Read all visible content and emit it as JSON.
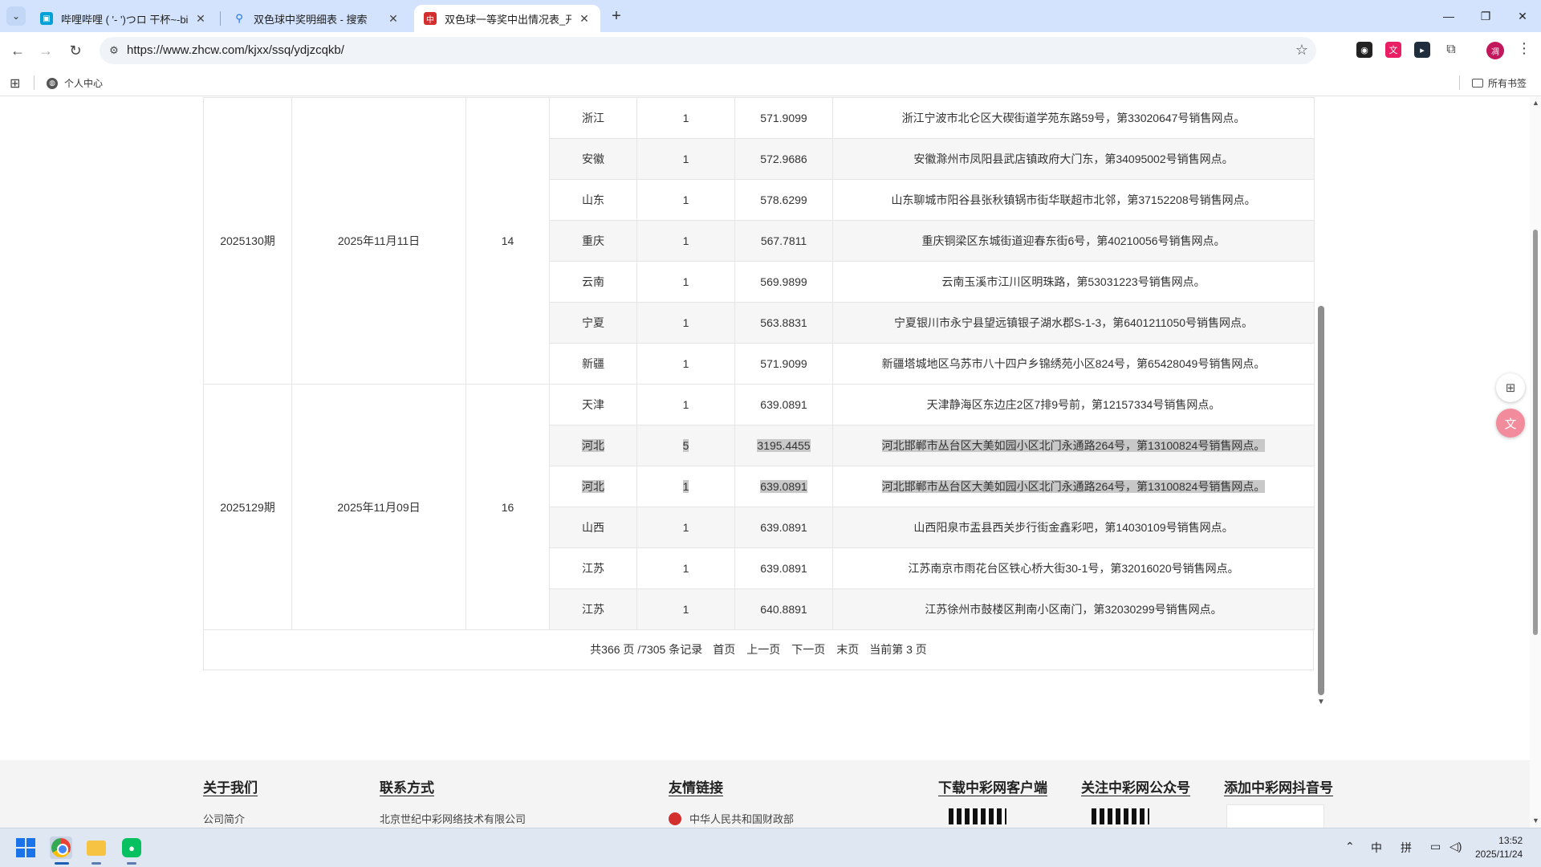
{
  "browser": {
    "tabs": [
      {
        "title": "哔哩哔哩 ( '- ')つロ 干杯~-bili",
        "active": false
      },
      {
        "title": "双色球中奖明细表 - 搜索",
        "active": false
      },
      {
        "title": "双色球一等奖中出情况表_开奖",
        "active": true
      }
    ],
    "url": "https://www.zhcw.com/kjxx/ssq/ydjzcqkb/",
    "bookmarks": {
      "item1": "个人中心",
      "all_bookmarks": "所有书签"
    },
    "profile_initial": "凋"
  },
  "table": {
    "rows": [
      {
        "issue": "2025130期",
        "date": "2025年11月11日",
        "count": "14",
        "region": "浙江",
        "num": "1",
        "amount": "571.9099",
        "location": "浙江宁波市北仑区大碶街道学苑东路59号，第33020647号销售网点。"
      },
      {
        "region": "安徽",
        "num": "1",
        "amount": "572.9686",
        "location": "安徽滁州市凤阳县武店镇政府大门东，第34095002号销售网点。"
      },
      {
        "region": "山东",
        "num": "1",
        "amount": "578.6299",
        "location": "山东聊城市阳谷县张秋镇锅市街华联超市北邻，第37152208号销售网点。"
      },
      {
        "region": "重庆",
        "num": "1",
        "amount": "567.7811",
        "location": "重庆铜梁区东城街道迎春东街6号，第40210056号销售网点。"
      },
      {
        "region": "云南",
        "num": "1",
        "amount": "569.9899",
        "location": "云南玉溪市江川区明珠路，第53031223号销售网点。"
      },
      {
        "region": "宁夏",
        "num": "1",
        "amount": "563.8831",
        "location": "宁夏银川市永宁县望远镇银子湖水郡S-1-3，第6401211050号销售网点。"
      },
      {
        "region": "新疆",
        "num": "1",
        "amount": "571.9099",
        "location": "新疆塔城地区乌苏市八十四户乡锦绣苑小区824号，第65428049号销售网点。"
      },
      {
        "issue": "2025129期",
        "date": "2025年11月09日",
        "count": "16",
        "region": "天津",
        "num": "1",
        "amount": "639.0891",
        "location": "天津静海区东边庄2区7排9号前，第12157334号销售网点。"
      },
      {
        "region": "河北",
        "num": "5",
        "amount": "3195.4455",
        "location": "河北邯郸市丛台区大美如园小区北门永通路264号，第13100824号销售网点。"
      },
      {
        "region": "河北",
        "num": "1",
        "amount": "639.0891",
        "location": "河北邯郸市丛台区大美如园小区北门永通路264号，第13100824号销售网点。"
      },
      {
        "region": "山西",
        "num": "1",
        "amount": "639.0891",
        "location": "山西阳泉市盂县西关步行街金鑫彩吧，第14030109号销售网点。"
      },
      {
        "region": "江苏",
        "num": "1",
        "amount": "639.0891",
        "location": "江苏南京市雨花台区铁心桥大街30-1号，第32016020号销售网点。"
      },
      {
        "region": "江苏",
        "num": "1",
        "amount": "640.8891",
        "location": "江苏徐州市鼓楼区荆南小区南门，第32030299号销售网点。"
      }
    ]
  },
  "pager": {
    "summary": "共366 页 /7305 条记录",
    "first": "首页",
    "prev": "上一页",
    "next": "下一页",
    "last": "末页",
    "current": "当前第 3 页"
  },
  "footer": {
    "about": {
      "heading": "关于我们",
      "link": "公司简介"
    },
    "contact": {
      "heading": "联系方式",
      "text": "北京世纪中彩网络技术有限公司"
    },
    "links": {
      "heading": "友情链接",
      "item": "中华人民共和国财政部"
    },
    "download": {
      "heading": "下载中彩网客户端"
    },
    "wechat": {
      "heading": "关注中彩网公众号"
    },
    "douyin": {
      "heading": "添加中彩网抖音号"
    }
  },
  "taskbar": {
    "ime1": "中",
    "ime2": "拼",
    "time": "13:52",
    "date": "2025/11/24"
  }
}
